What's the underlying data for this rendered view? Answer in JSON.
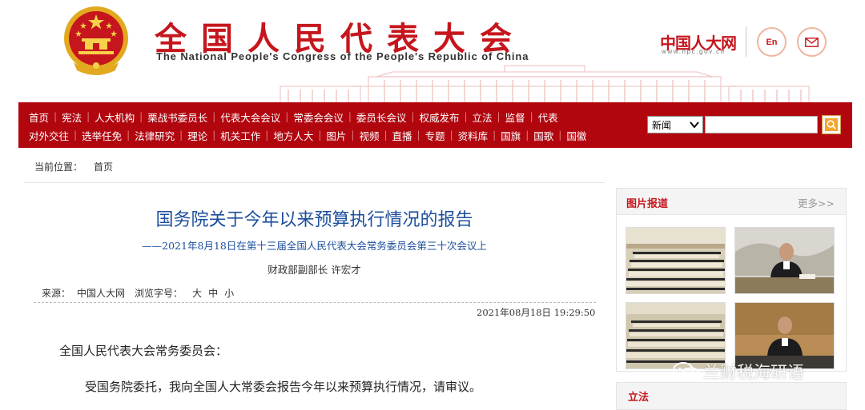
{
  "header": {
    "title_cn": "全国人民代表大会",
    "title_en": "The National People's Congress of the People's Republic of China",
    "logo_text": "中国人大网",
    "logo_url": "www.npc.gov.cn",
    "en_label": "En",
    "mail_icon": "mail-icon",
    "emblem_icon": "national-emblem-icon"
  },
  "nav": {
    "row1": [
      "首页",
      "宪法",
      "人大机构",
      "栗战书委员长",
      "代表大会会议",
      "常委会会议",
      "委员长会议",
      "权威发布",
      "立法",
      "监督",
      "代表"
    ],
    "row2": [
      "对外交往",
      "选举任免",
      "法律研究",
      "理论",
      "机关工作",
      "地方人大",
      "图片",
      "视频",
      "直播",
      "专题",
      "资料库",
      "国旗",
      "国歌",
      "国徽"
    ],
    "search_category": "新闻",
    "search_value": "",
    "search_icon": "search-icon"
  },
  "breadcrumb": {
    "label": "当前位置：",
    "current": "首页"
  },
  "article": {
    "title": "国务院关于今年以来预算执行情况的报告",
    "subtitle": "——2021年8月18日在第十三届全国人民代表大会常务委员会第三十次会议上",
    "author": "财政部副部长 许宏才",
    "source_label": "来源：",
    "source": "中国人大网",
    "font_label": "浏览字号：",
    "font_large": "大",
    "font_medium": "中",
    "font_small": "小",
    "datetime": "2021年08月18日  19:29:50",
    "p1": "全国人民代表大会常务委员会：",
    "p2": "受国务院委托，我向全国人大常委会报告今年以来预算执行情况，请审议。"
  },
  "sidebar": {
    "photo_title": "图片报道",
    "photo_more": "更多>>",
    "photos": [
      "meeting-hall-photo",
      "speaker-photo",
      "meeting-hall-photo-2",
      "speaker-photo-2"
    ],
    "next_title": "立法"
  },
  "watermark": {
    "text": "兰财税海研语",
    "icon": "wechat-icon"
  },
  "colors": {
    "brand_red": "#c6161d",
    "nav_red": "#b2060f",
    "title_blue": "#1d4f9c"
  }
}
